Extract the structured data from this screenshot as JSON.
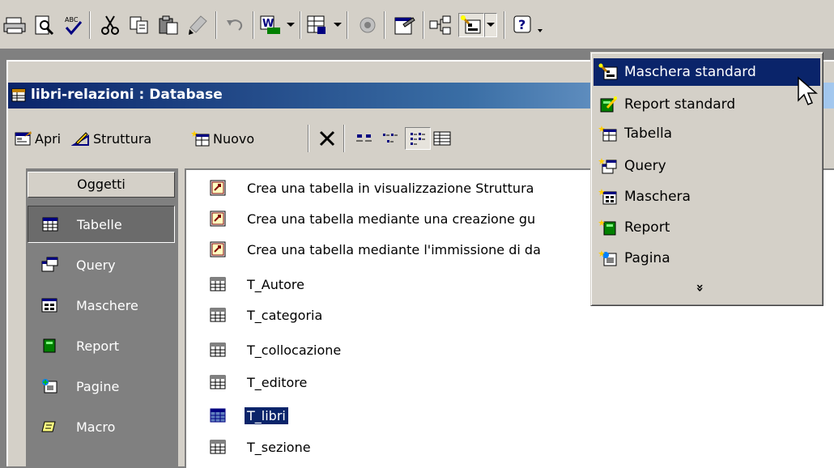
{
  "toolbar": {
    "buttons": [
      "print-icon",
      "print-preview-icon",
      "spelling-icon",
      "cut-icon",
      "copy-icon",
      "paste-icon",
      "format-painter-icon",
      "undo-icon",
      "office-links-icon",
      "analyze-icon",
      "code-icon",
      "properties-icon",
      "relationships-icon",
      "new-object-autoform-icon",
      "help-icon"
    ]
  },
  "db_window": {
    "title": "libri-relazioni : Database",
    "toolbar": {
      "open_label": "Apri",
      "design_label": "Struttura",
      "new_label": "Nuovo"
    }
  },
  "objects": {
    "header": "Oggetti",
    "items": [
      {
        "label": "Tabelle",
        "icon": "table-icon"
      },
      {
        "label": "Query",
        "icon": "query-icon"
      },
      {
        "label": "Maschere",
        "icon": "form-icon"
      },
      {
        "label": "Report",
        "icon": "report-icon"
      },
      {
        "label": "Pagine",
        "icon": "page-icon"
      },
      {
        "label": "Macro",
        "icon": "macro-icon"
      }
    ]
  },
  "list": {
    "items": [
      {
        "label": "Crea una tabella in visualizzazione Struttura",
        "icon": "wizard-shortcut-icon"
      },
      {
        "label": "Crea una tabella mediante una creazione gu",
        "icon": "wizard-shortcut-icon"
      },
      {
        "label": "Crea una tabella mediante l'immissione di da",
        "icon": "wizard-shortcut-icon"
      },
      {
        "label": "T_Autore",
        "icon": "table-icon"
      },
      {
        "label": "T_categoria",
        "icon": "table-icon"
      },
      {
        "label": "T_collocazione",
        "icon": "table-icon"
      },
      {
        "label": "T_editore",
        "icon": "table-icon"
      },
      {
        "label": "T_libri",
        "icon": "table-icon",
        "selected": true
      },
      {
        "label": "T_sezione",
        "icon": "table-icon"
      }
    ]
  },
  "menu": {
    "items": [
      {
        "label": "Maschera standard",
        "icon": "autoform-icon",
        "highlighted": true
      },
      {
        "label": "Report standard",
        "icon": "autoreport-icon"
      },
      {
        "label": "Tabella",
        "icon": "new-table-icon"
      },
      {
        "label": "Query",
        "icon": "new-query-icon"
      },
      {
        "label": "Maschera",
        "icon": "new-form-icon"
      },
      {
        "label": "Report",
        "icon": "new-report-icon"
      },
      {
        "label": "Pagina",
        "icon": "new-page-icon"
      }
    ],
    "more": "»"
  },
  "colors": {
    "highlight": "#0a246a",
    "face": "#d4d0c8",
    "dark": "#808080"
  }
}
